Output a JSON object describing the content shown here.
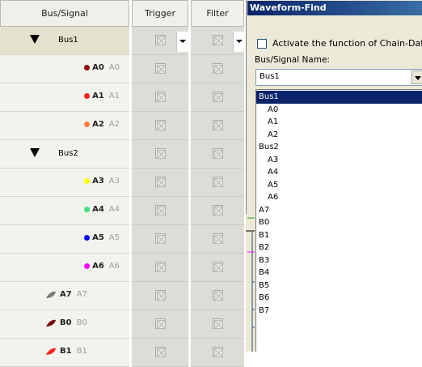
{
  "grid": {
    "headers": {
      "bus_signal": "Bus/Signal",
      "trigger": "Trigger",
      "filter": "Filter"
    },
    "rows": [
      {
        "kind": "bus",
        "label": "Bus1",
        "selected": true,
        "trigger_dropdown": true,
        "filter_dropdown": true
      },
      {
        "kind": "signal",
        "name": "A0",
        "ghost": "A0",
        "dot_color": "#8b1010"
      },
      {
        "kind": "signal",
        "name": "A1",
        "ghost": "A1",
        "dot_color": "#ff1e1e"
      },
      {
        "kind": "signal",
        "name": "A2",
        "ghost": "A2",
        "dot_color": "#ff8040"
      },
      {
        "kind": "bus",
        "label": "Bus2"
      },
      {
        "kind": "signal",
        "name": "A3",
        "ghost": "A3",
        "dot_color": "#ffff00"
      },
      {
        "kind": "signal",
        "name": "A4",
        "ghost": "A4",
        "dot_color": "#40e080"
      },
      {
        "kind": "signal",
        "name": "A5",
        "ghost": "A5",
        "dot_color": "#0000ff"
      },
      {
        "kind": "signal",
        "name": "A6",
        "ghost": "A6",
        "dot_color": "#ff00ff"
      },
      {
        "kind": "leaf",
        "name": "A7",
        "ghost": "A7",
        "leaf_color": "#7a7a7a"
      },
      {
        "kind": "leaf",
        "name": "B0",
        "ghost": "B0",
        "leaf_color": "#7a1010"
      },
      {
        "kind": "leaf",
        "name": "B1",
        "ghost": "B1",
        "leaf_color": "#ff1e1e"
      }
    ]
  },
  "dialog": {
    "title": "Waveform-Find",
    "chain_label": "Activate the function of Chain-Data",
    "bus_signal_label": "Bus/Signal Name:",
    "combo_value": "Bus1",
    "options": [
      {
        "label": "Bus1",
        "level": 0,
        "highlighted": true
      },
      {
        "label": "A0",
        "level": 1
      },
      {
        "label": "A1",
        "level": 1
      },
      {
        "label": "A2",
        "level": 1
      },
      {
        "label": "Bus2",
        "level": 0
      },
      {
        "label": "A3",
        "level": 1
      },
      {
        "label": "A4",
        "level": 1
      },
      {
        "label": "A5",
        "level": 1
      },
      {
        "label": "A6",
        "level": 1
      },
      {
        "label": "A7",
        "level": 0
      },
      {
        "label": "B0",
        "level": 0
      },
      {
        "label": "B1",
        "level": 0
      },
      {
        "label": "B2",
        "level": 0
      },
      {
        "label": "B3",
        "level": 0
      },
      {
        "label": "B4",
        "level": 0
      },
      {
        "label": "B5",
        "level": 0
      },
      {
        "label": "B6",
        "level": 0
      },
      {
        "label": "B7",
        "level": 0
      }
    ]
  },
  "colors": {
    "title_bar": "#0a246a",
    "highlight": "#0a246a",
    "dialog_bg": "#ece9d8",
    "grid_cell": "#dedcd6"
  }
}
